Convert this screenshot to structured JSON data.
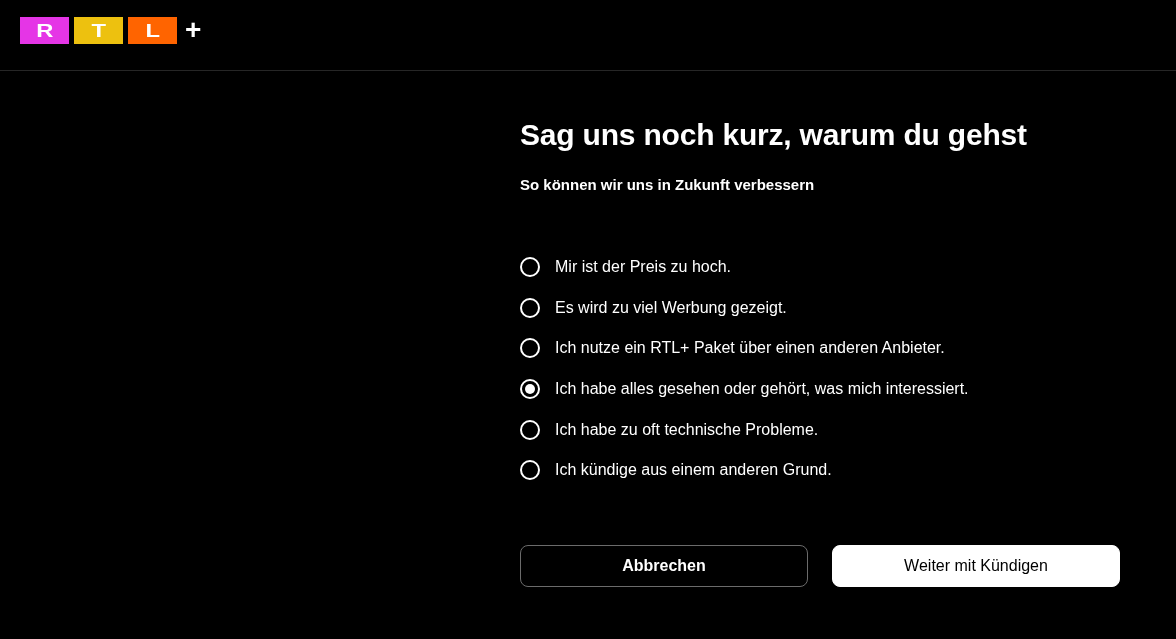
{
  "logo": {
    "letters": [
      {
        "text": "R",
        "color": "#e535e6"
      },
      {
        "text": "T",
        "color": "#edc10f"
      },
      {
        "text": "L",
        "color": "#ff6400"
      }
    ],
    "plus": "+"
  },
  "title": "Sag uns noch kurz, warum du gehst",
  "subtitle": "So können wir uns in Zukunft verbessern",
  "options": [
    {
      "label": "Mir ist der Preis zu hoch.",
      "selected": false
    },
    {
      "label": "Es wird zu viel Werbung gezeigt.",
      "selected": false
    },
    {
      "label": "Ich nutze ein RTL+ Paket über einen anderen Anbieter.",
      "selected": false
    },
    {
      "label": "Ich habe alles gesehen oder gehört, was mich interessiert.",
      "selected": true
    },
    {
      "label": "Ich habe zu oft technische Probleme.",
      "selected": false
    },
    {
      "label": "Ich kündige aus einem anderen Grund.",
      "selected": false
    }
  ],
  "buttons": [
    {
      "label": "Abbrechen",
      "kind": "secondary"
    },
    {
      "label": "Weiter mit Kündigen",
      "kind": "primary"
    }
  ]
}
